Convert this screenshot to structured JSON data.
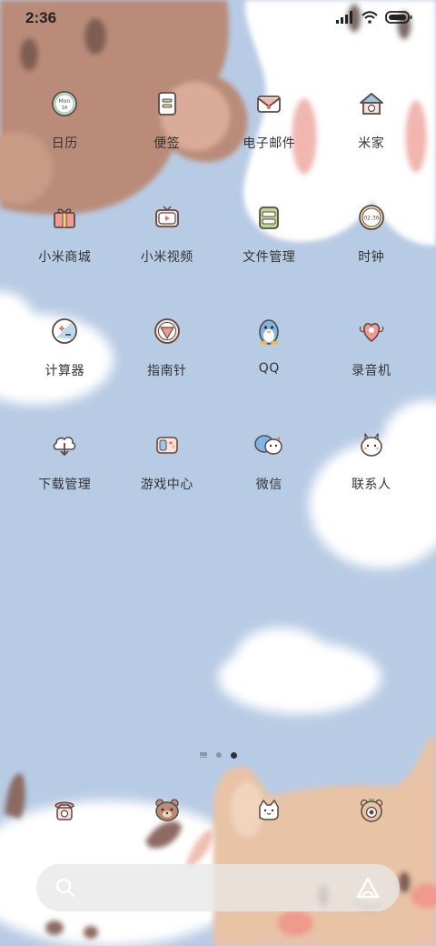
{
  "status_bar": {
    "time": "2:36",
    "icons": [
      "cellular-signal-icon",
      "wifi-icon",
      "battery-icon"
    ]
  },
  "apps": [
    {
      "label": "日历",
      "icon": "calendar-icon",
      "icon_text": "Mon",
      "icon_text2": "16"
    },
    {
      "label": "便签",
      "icon": "notes-icon"
    },
    {
      "label": "电子邮件",
      "icon": "email-icon"
    },
    {
      "label": "米家",
      "icon": "mijia-home-icon"
    },
    {
      "label": "小米商城",
      "icon": "gift-shop-icon"
    },
    {
      "label": "小米视频",
      "icon": "video-tv-icon"
    },
    {
      "label": "文件管理",
      "icon": "file-manager-icon"
    },
    {
      "label": "时钟",
      "icon": "clock-icon",
      "icon_text": "02:36"
    },
    {
      "label": "计算器",
      "icon": "calculator-icon"
    },
    {
      "label": "指南针",
      "icon": "compass-icon"
    },
    {
      "label": "QQ",
      "icon": "qq-penguin-icon"
    },
    {
      "label": "录音机",
      "icon": "recorder-icon"
    },
    {
      "label": "下载管理",
      "icon": "download-cloud-icon"
    },
    {
      "label": "游戏中心",
      "icon": "gamepad-icon"
    },
    {
      "label": "微信",
      "icon": "wechat-icon"
    },
    {
      "label": "联系人",
      "icon": "contacts-bunny-icon"
    }
  ],
  "page_indicator": {
    "pages": 3,
    "active": 2
  },
  "dock": [
    {
      "icon": "phone-icon"
    },
    {
      "icon": "bear-messages-icon"
    },
    {
      "icon": "cat-chat-icon"
    },
    {
      "icon": "camera-bear-icon"
    }
  ],
  "search_bar": {
    "icons": [
      "search-icon",
      "assistant-icon"
    ]
  },
  "colors": {
    "sky": "#b8cbe4",
    "bear": "#b98b78",
    "cloud": "#ffffff",
    "cat": "#e8c3a6",
    "label": "#333333"
  }
}
